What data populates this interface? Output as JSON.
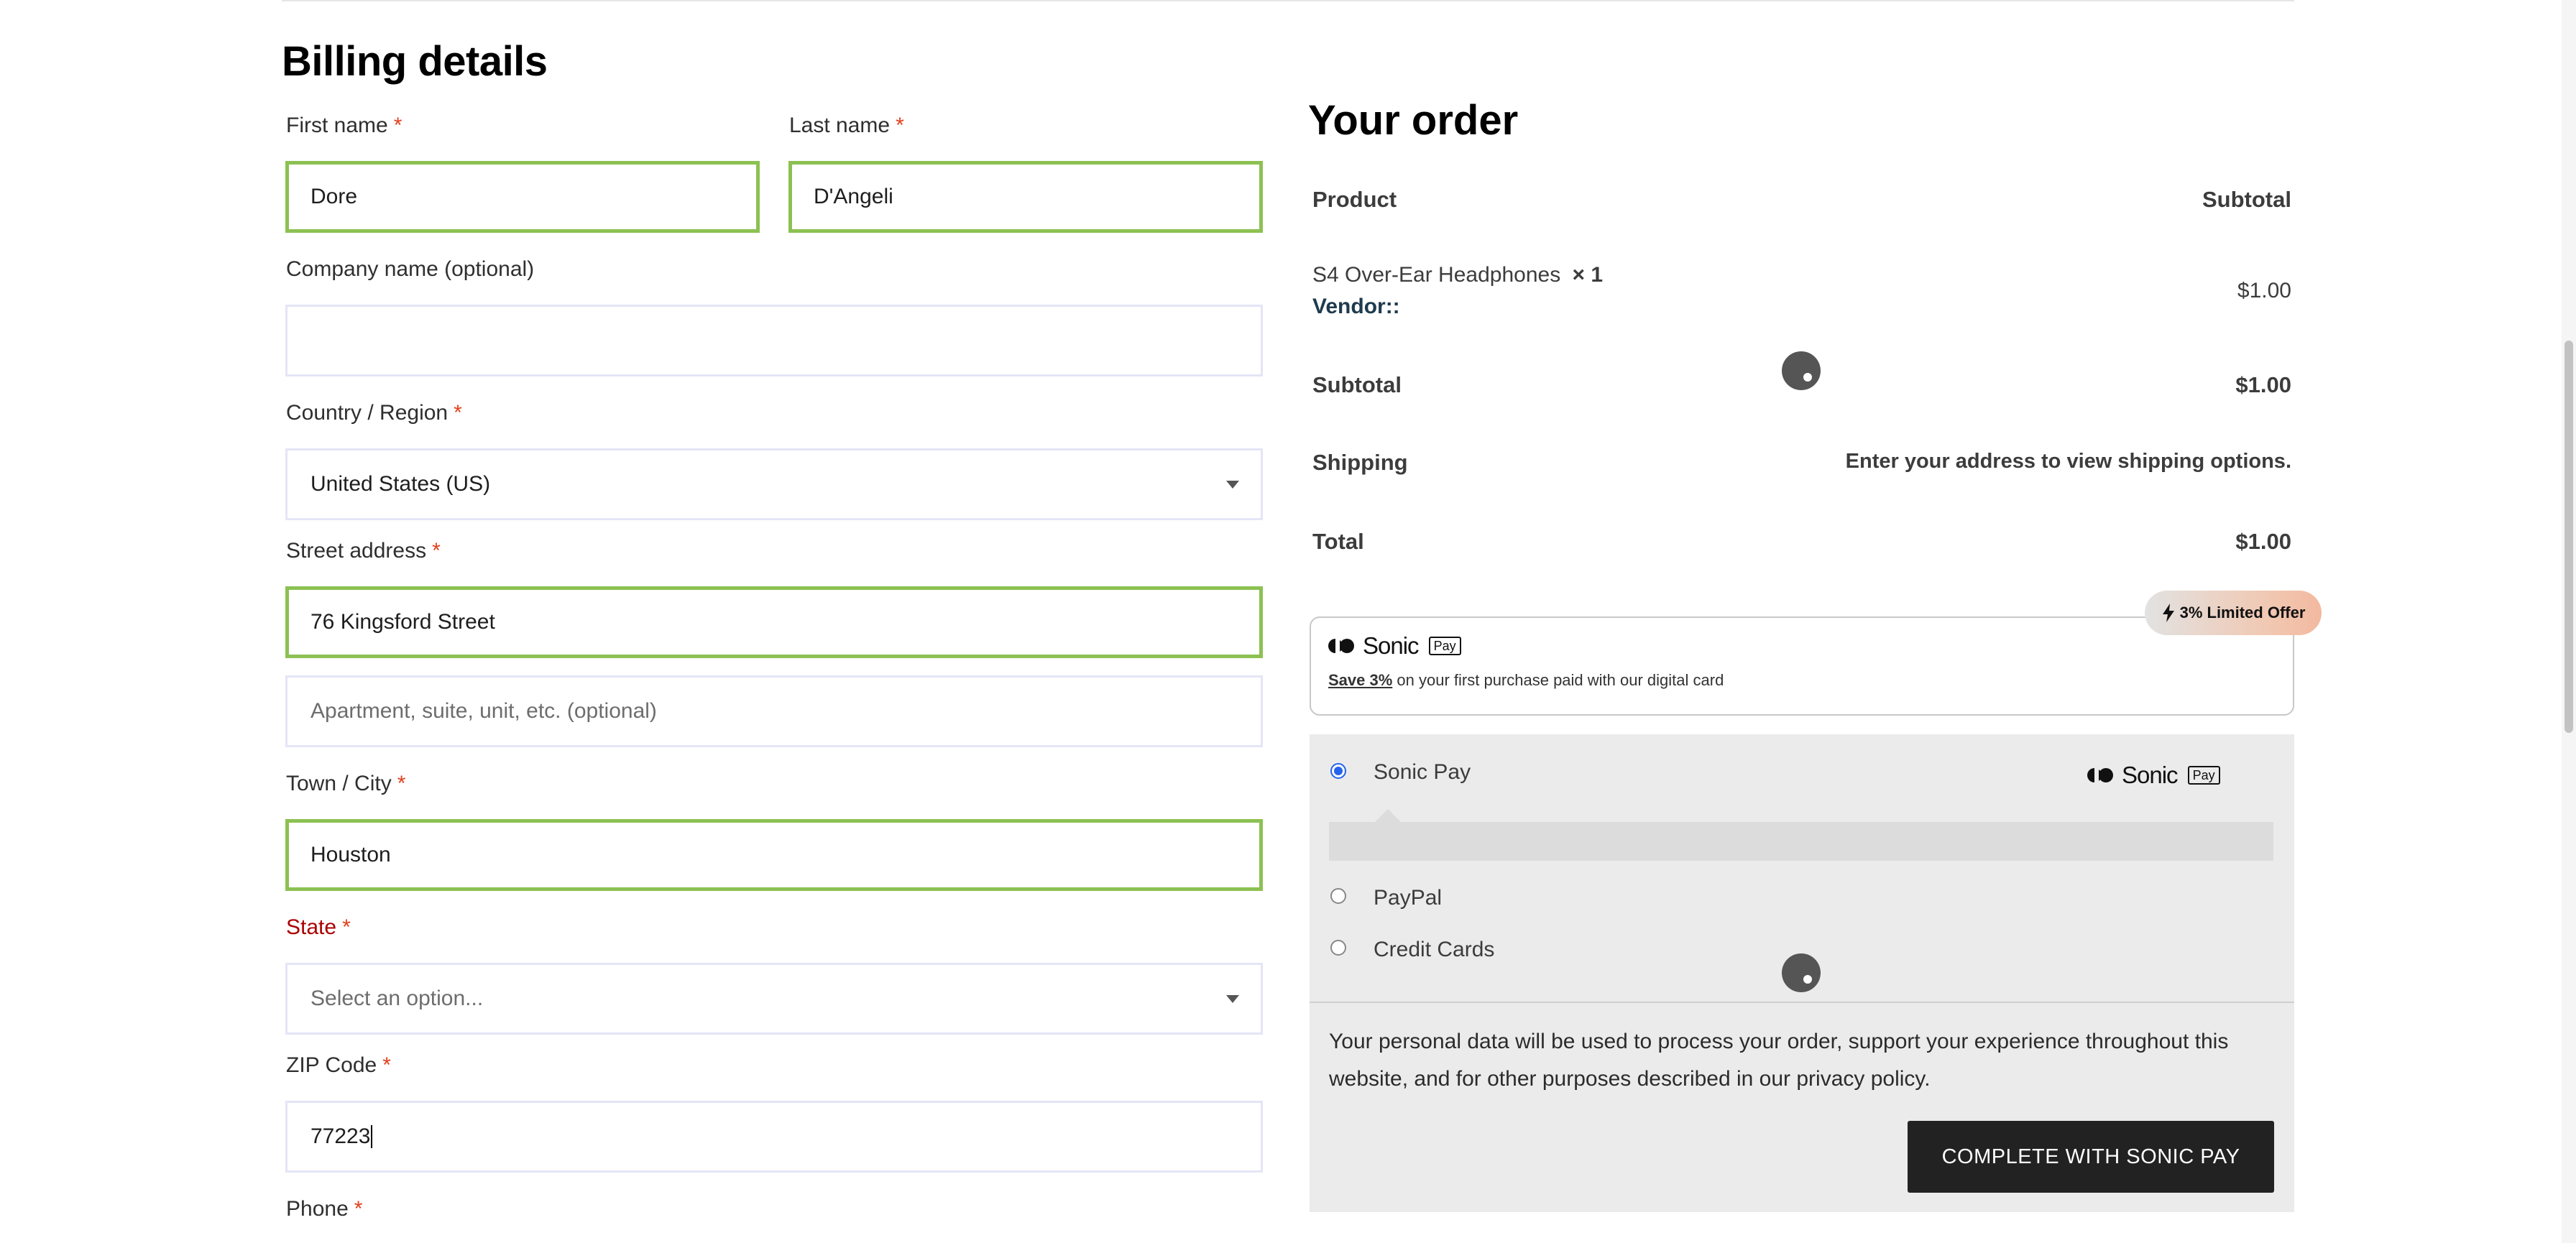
{
  "billing": {
    "title": "Billing details",
    "first_name": {
      "label": "First name",
      "required": "*",
      "value": "Dore"
    },
    "last_name": {
      "label": "Last name",
      "required": "*",
      "value": "D'Angeli"
    },
    "company": {
      "label": "Company name (optional)",
      "value": ""
    },
    "country": {
      "label": "Country / Region",
      "required": "*",
      "value": "United States (US)"
    },
    "street": {
      "label": "Street address",
      "required": "*",
      "value": "76 Kingsford Street",
      "apt_placeholder": "Apartment, suite, unit, etc. (optional)"
    },
    "city": {
      "label": "Town / City",
      "required": "*",
      "value": "Houston"
    },
    "state": {
      "label": "State",
      "required": "*",
      "placeholder": "Select an option..."
    },
    "zip": {
      "label": "ZIP Code",
      "required": "*",
      "value": "77223"
    },
    "phone": {
      "label": "Phone",
      "required": "*"
    }
  },
  "order": {
    "title": "Your order",
    "col_product": "Product",
    "col_subtotal": "Subtotal",
    "item": {
      "name": "S4 Over-Ear Headphones",
      "qty": "× 1",
      "vendor": "Vendor::",
      "price": "$1.00"
    },
    "subtotal": {
      "label": "Subtotal",
      "value": "$1.00"
    },
    "shipping": {
      "label": "Shipping",
      "value": "Enter your address to view shipping options."
    },
    "total": {
      "label": "Total",
      "value": "$1.00"
    }
  },
  "promo": {
    "badge": "3% Limited Offer",
    "brand": "Sonic",
    "pay_tag": "Pay",
    "save": "Save 3%",
    "text": " on your first purchase paid with our digital card"
  },
  "payment": {
    "methods": [
      {
        "label": "Sonic Pay",
        "selected": true
      },
      {
        "label": "PayPal",
        "selected": false
      },
      {
        "label": "Credit Cards",
        "selected": false
      }
    ],
    "privacy_text": "Your personal data will be used to process your order, support your experience throughout this website, and for other purposes described in our privacy policy.",
    "button_label": "COMPLETE WITH SONIC PAY"
  },
  "colors": {
    "valid_border": "#8cc152",
    "required": "#e2401c",
    "accent": "#2563eb",
    "button": "#222222"
  },
  "icons": [
    "chevron-down-icon",
    "lightning-icon",
    "sonic-logo-icon",
    "loading-spinner-icon"
  ]
}
